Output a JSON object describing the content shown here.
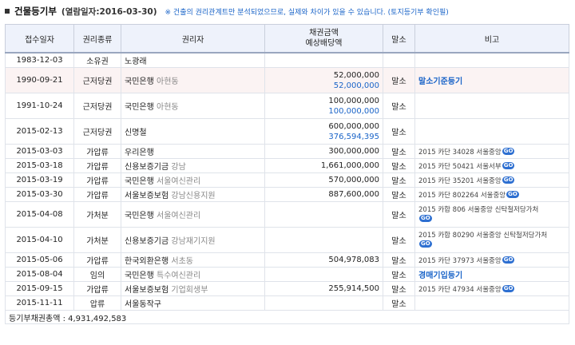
{
  "header": {
    "title": "건물등기부",
    "subtitle": "(열람일자:2016-03-30)",
    "notice": "※ 건출의 권리관계트만 분석되었으므로, 실제와 차이가 있을 수 있습니다. (토지등기부 확인필)"
  },
  "columns": {
    "date": "접수일자",
    "type": "권리종류",
    "holder": "권리자",
    "amount_line1": "채권금액",
    "amount_line2": "예상배당액",
    "cancel": "말소",
    "note": "비고"
  },
  "rows": [
    {
      "date": "1983-12-03",
      "type": "소유권",
      "holder": "노광래",
      "holder_sub": "",
      "amount": "",
      "dividend": "",
      "cancel": "",
      "note": "",
      "note_link": "",
      "go": ""
    },
    {
      "date": "1990-09-21",
      "type": "근저당권",
      "holder": "국민은행",
      "holder_sub": "아현동",
      "amount": "52,000,000",
      "dividend": "52,000,000",
      "cancel": "말소",
      "note": "",
      "note_link": "말소기준등기",
      "go": ""
    },
    {
      "date": "1991-10-24",
      "type": "근저당권",
      "holder": "국민은행",
      "holder_sub": "아현동",
      "amount": "100,000,000",
      "dividend": "100,000,000",
      "cancel": "말소",
      "note": "",
      "note_link": "",
      "go": ""
    },
    {
      "date": "2015-02-13",
      "type": "근저당권",
      "holder": "신명철",
      "holder_sub": "",
      "amount": "600,000,000",
      "dividend": "376,594,395",
      "cancel": "말소",
      "note": "",
      "note_link": "",
      "go": ""
    },
    {
      "date": "2015-03-03",
      "type": "가압류",
      "holder": "우리은행",
      "holder_sub": "",
      "amount": "300,000,000",
      "dividend": "",
      "cancel": "말소",
      "note": "2015 카단 34028 서울중앙",
      "note_link": "",
      "go": "GO"
    },
    {
      "date": "2015-03-18",
      "type": "가압류",
      "holder": "신용보증기금",
      "holder_sub": "강남",
      "amount": "1,661,000,000",
      "dividend": "",
      "cancel": "말소",
      "note": "2015 카단 50421 서울서부",
      "note_link": "",
      "go": "GO"
    },
    {
      "date": "2015-03-19",
      "type": "가압류",
      "holder": "국민은행",
      "holder_sub": "서울여신관리",
      "amount": "570,000,000",
      "dividend": "",
      "cancel": "말소",
      "note": "2015 카단 35201 서울중앙",
      "note_link": "",
      "go": "GO"
    },
    {
      "date": "2015-03-30",
      "type": "가압류",
      "holder": "서울보증보험",
      "holder_sub": "강남신용지원",
      "amount": "887,600,000",
      "dividend": "",
      "cancel": "말소",
      "note": "2015 카단 802264 서울중앙",
      "note_link": "",
      "go": "GO"
    },
    {
      "date": "2015-04-08",
      "type": "가처분",
      "holder": "국민은행",
      "holder_sub": "서울여신관리",
      "amount": "",
      "dividend": "",
      "cancel": "말소",
      "note": "2015 카합 806 서울중앙 신탁철저당가처",
      "note_link": "",
      "go": "GO"
    },
    {
      "date": "2015-04-10",
      "type": "가처분",
      "holder": "신용보증기금",
      "holder_sub": "강남재기지원",
      "amount": "",
      "dividend": "",
      "cancel": "말소",
      "note": "2015 카합 80290 서울중앙 신탁철저당가처",
      "note_link": "",
      "go": "GO"
    },
    {
      "date": "2015-05-06",
      "type": "가압류",
      "holder": "한국외환은행",
      "holder_sub": "서초동",
      "amount": "504,978,083",
      "dividend": "",
      "cancel": "말소",
      "note": "2015 카단 37973 서울중앙",
      "note_link": "",
      "go": "GO"
    },
    {
      "date": "2015-08-04",
      "type": "임의",
      "holder": "국민은행",
      "holder_sub": "특수여신관리",
      "amount": "",
      "dividend": "",
      "cancel": "말소",
      "note": "",
      "note_link": "경매기입등기",
      "go": ""
    },
    {
      "date": "2015-09-15",
      "type": "가압류",
      "holder": "서울보증보험",
      "holder_sub": "기업회생부",
      "amount": "255,914,500",
      "dividend": "",
      "cancel": "말소",
      "note": "2015 카단 47934 서울중앙",
      "note_link": "",
      "go": "GO"
    },
    {
      "date": "2015-11-11",
      "type": "압류",
      "holder": "서울동작구",
      "holder_sub": "",
      "amount": "",
      "dividend": "",
      "cancel": "말소",
      "note": "",
      "note_link": "",
      "go": ""
    }
  ],
  "footer": {
    "total": "등기부채권총액 : 4,931,492,583"
  }
}
